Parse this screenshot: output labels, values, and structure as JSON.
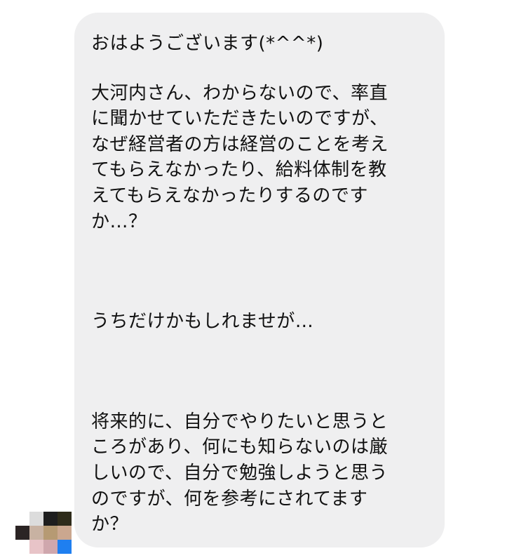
{
  "messages": [
    {
      "paragraphs": [
        "おはようございます(*^^*)",
        "大河内さん、わからないので、率直\nに聞かせていただきたいのですが、\nなぜ経営者の方は経営のことを考え\nてもらえなかったり、給料体制を教\nえてもらえなかったりするのです\nか…？",
        "うちだけかもしれませが…",
        "将来的に、自分でやりたいと思うと\nころがあり、何にも知らないのは厳\nしいので、自分で勉強しようと思う\nのですが、何を参考にされてます\nか？"
      ]
    }
  ],
  "avatar": {
    "type": "pixelated-avatar",
    "pixels": [
      [
        "#ffffff",
        "#dcdcdc",
        "#1e1e1e",
        "#2e2b1a"
      ],
      [
        "#2b2424",
        "#c8b2a2",
        "#b69a73",
        "#cba78f"
      ],
      [
        "#ffffff",
        "#e8c4c8",
        "#cfa7ad",
        "#1f7ff0"
      ]
    ]
  }
}
